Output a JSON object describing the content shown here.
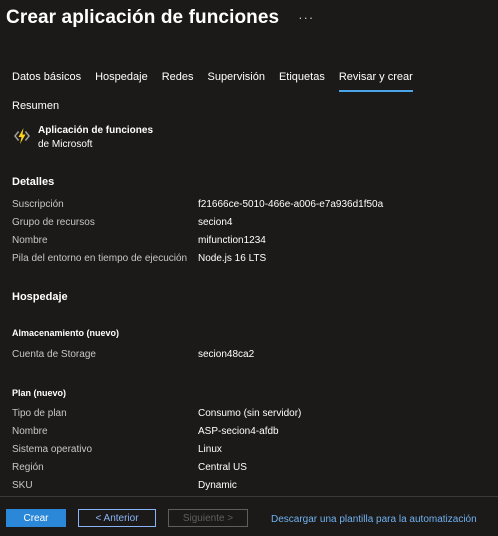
{
  "header": {
    "title": "Crear aplicación de funciones",
    "more": "···"
  },
  "tabs": [
    {
      "label": "Datos básicos",
      "active": false
    },
    {
      "label": "Hospedaje",
      "active": false
    },
    {
      "label": "Redes",
      "active": false
    },
    {
      "label": "Supervisión",
      "active": false
    },
    {
      "label": "Etiquetas",
      "active": false
    },
    {
      "label": "Revisar y crear",
      "active": true
    }
  ],
  "summary": {
    "heading": "Resumen",
    "product_name": "Aplicación de funciones",
    "product_publisher": "de Microsoft",
    "icon": "function-app-bolt-icon"
  },
  "details": {
    "heading": "Detalles",
    "rows": [
      {
        "key": "Suscripción",
        "value": "f21666ce-5010-466e-a006-e7a936d1f50a"
      },
      {
        "key": "Grupo de recursos",
        "value": "secion4"
      },
      {
        "key": "Nombre",
        "value": "mifunction1234"
      },
      {
        "key": "Pila del entorno en tiempo de ejecución",
        "value": "Node.js 16 LTS"
      }
    ]
  },
  "hosting": {
    "heading": "Hospedaje",
    "storage_heading": "Almacenamiento (nuevo)",
    "storage_rows": [
      {
        "key": "Cuenta de Storage",
        "value": "secion48ca2"
      }
    ],
    "plan_heading": "Plan (nuevo)",
    "plan_rows": [
      {
        "key": "Tipo de plan",
        "value": "Consumo (sin servidor)"
      },
      {
        "key": "Nombre",
        "value": "ASP-secion4-afdb"
      },
      {
        "key": "Sistema operativo",
        "value": "Linux"
      },
      {
        "key": "Región",
        "value": "Central US"
      },
      {
        "key": "SKU",
        "value": "Dynamic"
      }
    ]
  },
  "footer": {
    "create": "Crear",
    "previous": "< Anterior",
    "next": "Siguiente >",
    "download": "Descargar una plantilla para la automatización"
  },
  "colors": {
    "background": "#1b1a19",
    "accent": "#2b88d8",
    "link": "#70b1ef",
    "tab_underline": "#4ba3e8"
  }
}
